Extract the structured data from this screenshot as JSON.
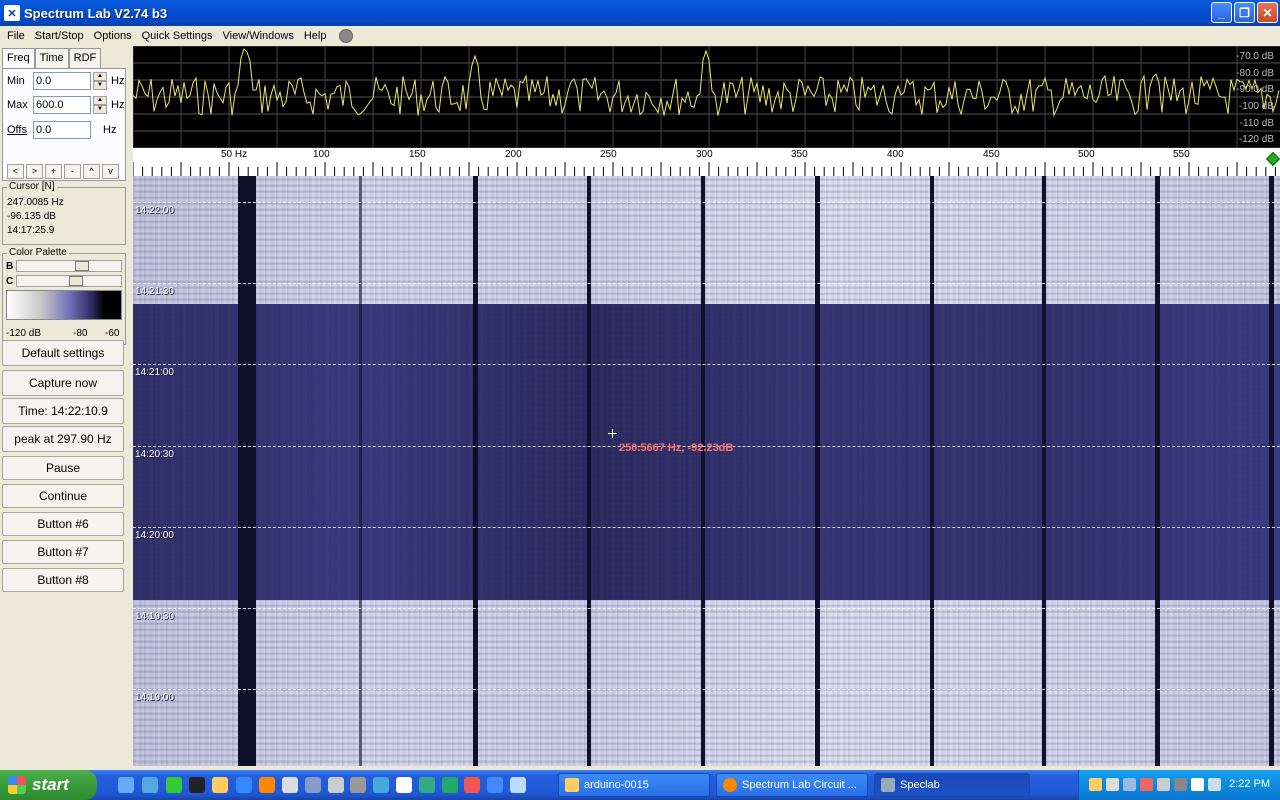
{
  "window": {
    "title": "Spectrum Lab V2.74 b3",
    "controls": [
      "_",
      "❐",
      "✕"
    ]
  },
  "menu": {
    "items": [
      "File",
      "Start/Stop",
      "Options",
      "Quick Settings",
      "View/Windows",
      "Help"
    ]
  },
  "left": {
    "tabs": [
      "Freq",
      "Time",
      "RDF"
    ],
    "min_label": "Min",
    "min_value": "0.0",
    "max_label": "Max",
    "max_value": "600.0",
    "offs_label": "Offs",
    "offs_value": "0.0",
    "unit": "Hz",
    "nav_buttons": [
      "<",
      ">",
      "+",
      "-",
      "^",
      "v"
    ],
    "cursor": {
      "legend": "Cursor [N]",
      "freq": "247.0085 Hz",
      "level": "-96.135 dB",
      "time": "14:17:25.9"
    },
    "palette": {
      "legend": "Color Palette",
      "b_label": "B",
      "c_label": "C",
      "scale": [
        "-120 dB",
        "-80",
        "-60"
      ]
    },
    "buttons": [
      "Default settings",
      "Capture now",
      "Time:  14:22:10.9",
      "peak at 297.90 Hz",
      "Pause",
      "Continue",
      "Button #6",
      "Button #7",
      "Button #8"
    ]
  },
  "spectrum": {
    "db_labels": [
      "-70.0 dB",
      "-80.0 dB",
      "-90.0 dB",
      "-100 dB",
      "-110 dB",
      "-120 dB"
    ]
  },
  "freq_axis": {
    "labels": [
      "50 Hz",
      "100",
      "150",
      "200",
      "250",
      "300",
      "350",
      "400",
      "450",
      "500",
      "550"
    ]
  },
  "waterfall": {
    "time_labels": [
      "14:22:00",
      "14:21:30",
      "14:21:00",
      "14:20:30",
      "14:20:00",
      "14:19:30",
      "14:19:00"
    ],
    "cursor_readout": "250.5667 Hz, -92.23dB"
  },
  "taskbar": {
    "start": "start",
    "tasks": [
      "arduino-0015",
      "Spectrum Lab Circuit ...",
      "Speclab"
    ],
    "clock": "2:22 PM"
  }
}
